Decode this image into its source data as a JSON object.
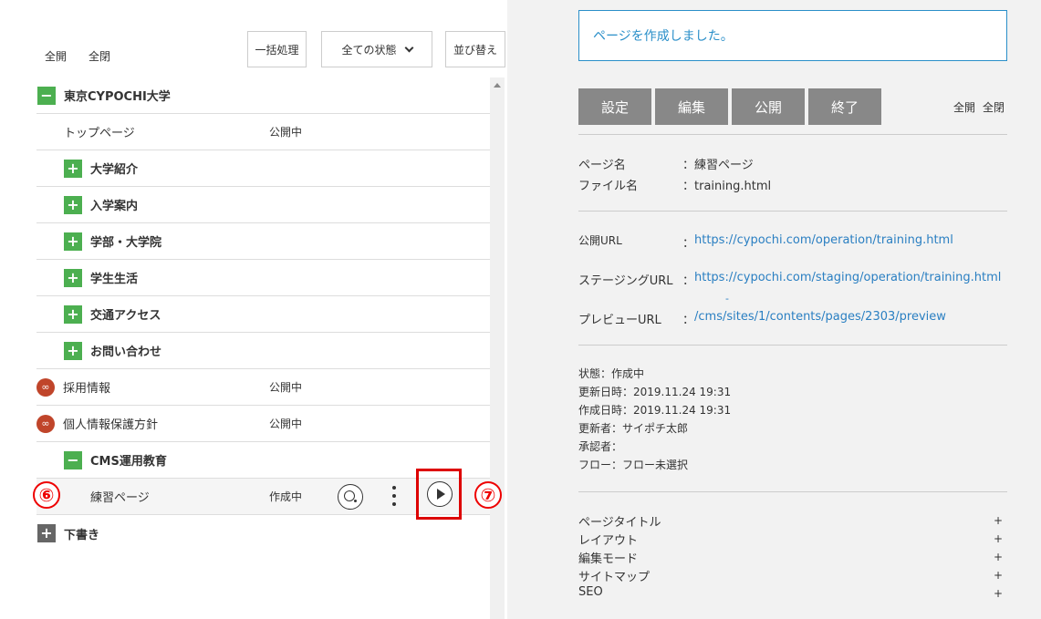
{
  "left": {
    "expand_all": "全開",
    "collapse_all": "全閉",
    "bulk_button": "一括処理",
    "status_select": "全ての状態",
    "sort_button": "並び替え",
    "tree": [
      {
        "label": "東京CYPOCHI大学",
        "status": "",
        "toggle": "−"
      },
      {
        "label": "トップページ",
        "status": "公開中"
      },
      {
        "label": "大学紹介",
        "status": "",
        "toggle": "+"
      },
      {
        "label": "入学案内",
        "status": "",
        "toggle": "+"
      },
      {
        "label": "学部・大学院",
        "status": "",
        "toggle": "+"
      },
      {
        "label": "学生生活",
        "status": "",
        "toggle": "+"
      },
      {
        "label": "交通アクセス",
        "status": "",
        "toggle": "+"
      },
      {
        "label": "お問い合わせ",
        "status": "",
        "toggle": "+"
      },
      {
        "label": "採用情報",
        "status": "公開中"
      },
      {
        "label": "個人情報保護方針",
        "status": "公開中"
      },
      {
        "label": "CMS運用教育",
        "status": "",
        "toggle": "−"
      },
      {
        "label": "練習ページ",
        "status": "作成中"
      },
      {
        "label": "下書き",
        "status": "",
        "toggle": "+"
      }
    ],
    "badge_6": "⑥",
    "badge_7": "⑦"
  },
  "right": {
    "alert": "ページを作成しました。",
    "buttons": [
      "設定",
      "編集",
      "公開",
      "終了"
    ],
    "expand_all": "全開",
    "collapse_all": "全閉",
    "info": {
      "page_name_label": "ページ名",
      "page_name_value": "：練習ページ",
      "file_name_label": "ファイル名",
      "file_name_value": "：training.html"
    },
    "urls": {
      "public_label": "公開URL",
      "public_colon": "：",
      "public_value": "https://cypochi.com/operation/training.html",
      "staging_label": "ステージングURL",
      "staging_colon": "：",
      "staging_value": "https://cypochi.com/staging/operation/training.html",
      "preview_label": "プレビューURL",
      "preview_dash": "-",
      "preview_colon": "：",
      "preview_value": "/cms/sites/1/contents/pages/2303/preview"
    },
    "meta": [
      "状態：作成中",
      "更新日時：2019.11.24 19:31",
      "作成日時：2019.11.24 19:31",
      "更新者：サイポチ太郎",
      "承認者：",
      "フロー：フロー未選択"
    ],
    "sections": [
      "ページタイトル",
      "レイアウト",
      "編集モード",
      "サイトマップ",
      "SEO"
    ],
    "plus": "+"
  }
}
